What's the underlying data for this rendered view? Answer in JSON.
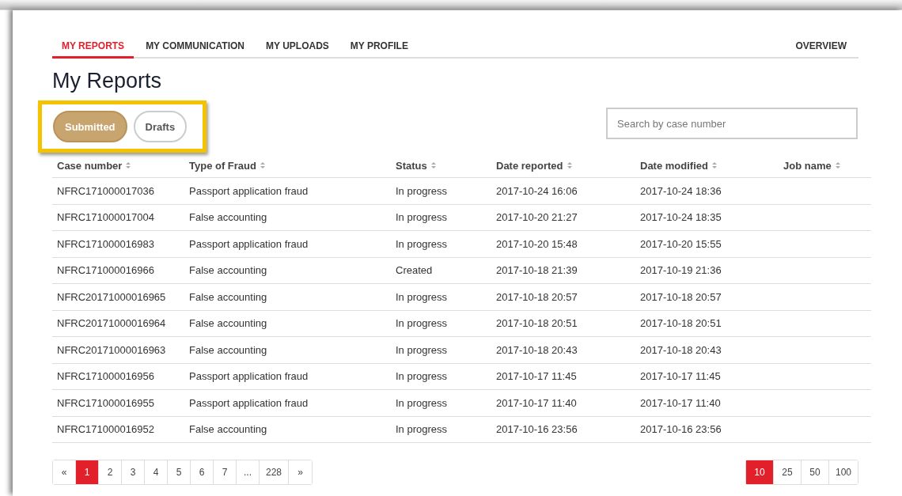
{
  "nav": {
    "tabs": [
      {
        "label": "MY REPORTS",
        "selected": true
      },
      {
        "label": "MY COMMUNICATION",
        "selected": false
      },
      {
        "label": "MY UPLOADS",
        "selected": false
      },
      {
        "label": "MY PROFILE",
        "selected": false
      }
    ],
    "right_link": "OVERVIEW"
  },
  "title": "My Reports",
  "filters": [
    {
      "label": "Submitted",
      "selected": true
    },
    {
      "label": "Drafts",
      "selected": false
    }
  ],
  "search": {
    "placeholder": "Search by case number"
  },
  "table": {
    "columns": [
      "Case number",
      "Type of Fraud",
      "Status",
      "Date reported",
      "Date modified",
      "Job name"
    ],
    "rows": [
      [
        "NFRC171000017036",
        "Passport application fraud",
        "In progress",
        "2017-10-24 16:06",
        "2017-10-24 18:36"
      ],
      [
        "NFRC171000017004",
        "False accounting",
        "In progress",
        "2017-10-20 21:27",
        "2017-10-24 18:35"
      ],
      [
        "NFRC171000016983",
        "Passport application fraud",
        "In progress",
        "2017-10-20 15:48",
        "2017-10-20 15:55"
      ],
      [
        "NFRC171000016966",
        "False accounting",
        "Created",
        "2017-10-18 21:39",
        "2017-10-19 21:36"
      ],
      [
        "NFRC20171000016965",
        "False accounting",
        "In progress",
        "2017-10-18 20:57",
        "2017-10-18 20:57"
      ],
      [
        "NFRC20171000016964",
        "False accounting",
        "In progress",
        "2017-10-18 20:51",
        "2017-10-18 20:51"
      ],
      [
        "NFRC20171000016963",
        "False accounting",
        "In progress",
        "2017-10-18 20:43",
        "2017-10-18 20:43"
      ],
      [
        "NFRC171000016956",
        "Passport application fraud",
        "In progress",
        "2017-10-17 11:45",
        "2017-10-17 11:45"
      ],
      [
        "NFRC171000016955",
        "Passport application fraud",
        "In progress",
        "2017-10-17 11:40",
        "2017-10-17 11:40"
      ],
      [
        "NFRC171000016952",
        "False accounting",
        "In progress",
        "2017-10-16 23:56",
        "2017-10-16 23:56"
      ]
    ]
  },
  "pagination": {
    "pages": [
      {
        "label": "«",
        "selected": false
      },
      {
        "label": "1",
        "selected": true
      },
      {
        "label": "2",
        "selected": false
      },
      {
        "label": "3",
        "selected": false
      },
      {
        "label": "4",
        "selected": false
      },
      {
        "label": "5",
        "selected": false
      },
      {
        "label": "6",
        "selected": false
      },
      {
        "label": "7",
        "selected": false
      },
      {
        "label": "...",
        "selected": false
      },
      {
        "label": "228",
        "selected": false
      },
      {
        "label": "»",
        "selected": false
      }
    ],
    "page_sizes": [
      {
        "label": "10",
        "selected": true
      },
      {
        "label": "25",
        "selected": false
      },
      {
        "label": "50",
        "selected": false
      },
      {
        "label": "100",
        "selected": false
      }
    ]
  }
}
